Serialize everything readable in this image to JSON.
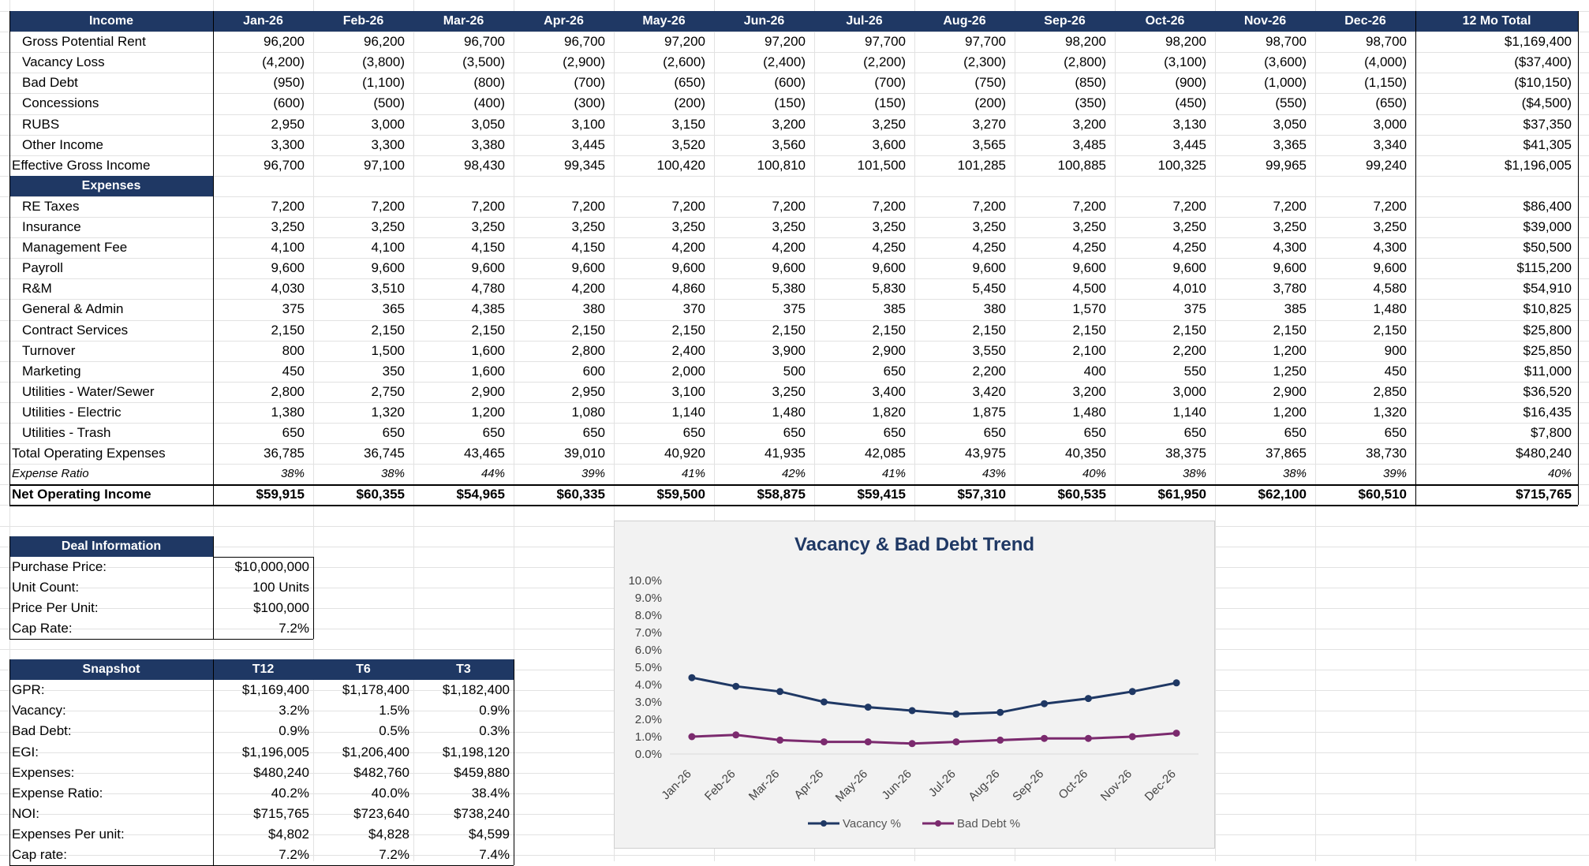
{
  "months": [
    "Jan-26",
    "Feb-26",
    "Mar-26",
    "Apr-26",
    "May-26",
    "Jun-26",
    "Jul-26",
    "Aug-26",
    "Sep-26",
    "Oct-26",
    "Nov-26",
    "Dec-26"
  ],
  "total_header": "12 Mo Total",
  "income_header": "Income",
  "expenses_header": "Expenses",
  "income_rows": [
    {
      "label": "Gross Potential Rent",
      "indent": true,
      "bold": false,
      "values": [
        "96,200",
        "96,200",
        "96,700",
        "96,700",
        "97,200",
        "97,200",
        "97,700",
        "97,700",
        "98,200",
        "98,200",
        "98,700",
        "98,700"
      ],
      "total": "$1,169,400"
    },
    {
      "label": "Vacancy Loss",
      "indent": true,
      "bold": false,
      "values": [
        "(4,200)",
        "(3,800)",
        "(3,500)",
        "(2,900)",
        "(2,600)",
        "(2,400)",
        "(2,200)",
        "(2,300)",
        "(2,800)",
        "(3,100)",
        "(3,600)",
        "(4,000)"
      ],
      "total": "($37,400)"
    },
    {
      "label": "Bad Debt",
      "indent": true,
      "bold": false,
      "values": [
        "(950)",
        "(1,100)",
        "(800)",
        "(700)",
        "(650)",
        "(600)",
        "(700)",
        "(750)",
        "(850)",
        "(900)",
        "(1,000)",
        "(1,150)"
      ],
      "total": "($10,150)"
    },
    {
      "label": "Concessions",
      "indent": true,
      "bold": false,
      "values": [
        "(600)",
        "(500)",
        "(400)",
        "(300)",
        "(200)",
        "(150)",
        "(150)",
        "(200)",
        "(350)",
        "(450)",
        "(550)",
        "(650)"
      ],
      "total": "($4,500)"
    },
    {
      "label": "RUBS",
      "indent": true,
      "bold": false,
      "values": [
        "2,950",
        "3,000",
        "3,050",
        "3,100",
        "3,150",
        "3,200",
        "3,250",
        "3,270",
        "3,200",
        "3,130",
        "3,050",
        "3,000"
      ],
      "total": "$37,350"
    },
    {
      "label": "Other Income",
      "indent": true,
      "bold": false,
      "values": [
        "3,300",
        "3,300",
        "3,380",
        "3,445",
        "3,520",
        "3,560",
        "3,600",
        "3,565",
        "3,485",
        "3,445",
        "3,365",
        "3,340"
      ],
      "total": "$41,305"
    },
    {
      "label": "Effective Gross Income",
      "indent": false,
      "bold": false,
      "values": [
        "96,700",
        "97,100",
        "98,430",
        "99,345",
        "100,420",
        "100,810",
        "101,500",
        "101,285",
        "100,885",
        "100,325",
        "99,965",
        "99,240"
      ],
      "total": "$1,196,005"
    }
  ],
  "expense_rows": [
    {
      "label": "RE Taxes",
      "indent": true,
      "values": [
        "7,200",
        "7,200",
        "7,200",
        "7,200",
        "7,200",
        "7,200",
        "7,200",
        "7,200",
        "7,200",
        "7,200",
        "7,200",
        "7,200"
      ],
      "total": "$86,400"
    },
    {
      "label": "Insurance",
      "indent": true,
      "values": [
        "3,250",
        "3,250",
        "3,250",
        "3,250",
        "3,250",
        "3,250",
        "3,250",
        "3,250",
        "3,250",
        "3,250",
        "3,250",
        "3,250"
      ],
      "total": "$39,000"
    },
    {
      "label": "Management Fee",
      "indent": true,
      "values": [
        "4,100",
        "4,100",
        "4,150",
        "4,150",
        "4,200",
        "4,200",
        "4,250",
        "4,250",
        "4,250",
        "4,250",
        "4,300",
        "4,300"
      ],
      "total": "$50,500"
    },
    {
      "label": "Payroll",
      "indent": true,
      "values": [
        "9,600",
        "9,600",
        "9,600",
        "9,600",
        "9,600",
        "9,600",
        "9,600",
        "9,600",
        "9,600",
        "9,600",
        "9,600",
        "9,600"
      ],
      "total": "$115,200"
    },
    {
      "label": "R&M",
      "indent": true,
      "values": [
        "4,030",
        "3,510",
        "4,780",
        "4,200",
        "4,860",
        "5,380",
        "5,830",
        "5,450",
        "4,500",
        "4,010",
        "3,780",
        "4,580"
      ],
      "total": "$54,910"
    },
    {
      "label": "General & Admin",
      "indent": true,
      "values": [
        "375",
        "365",
        "4,385",
        "380",
        "370",
        "375",
        "385",
        "380",
        "1,570",
        "375",
        "385",
        "1,480"
      ],
      "total": "$10,825"
    },
    {
      "label": "Contract Services",
      "indent": true,
      "values": [
        "2,150",
        "2,150",
        "2,150",
        "2,150",
        "2,150",
        "2,150",
        "2,150",
        "2,150",
        "2,150",
        "2,150",
        "2,150",
        "2,150"
      ],
      "total": "$25,800"
    },
    {
      "label": "Turnover",
      "indent": true,
      "values": [
        "800",
        "1,500",
        "1,600",
        "2,800",
        "2,400",
        "3,900",
        "2,900",
        "3,550",
        "2,100",
        "2,200",
        "1,200",
        "900"
      ],
      "total": "$25,850"
    },
    {
      "label": "Marketing",
      "indent": true,
      "values": [
        "450",
        "350",
        "1,600",
        "600",
        "2,000",
        "500",
        "650",
        "2,200",
        "400",
        "550",
        "1,250",
        "450"
      ],
      "total": "$11,000"
    },
    {
      "label": "Utilities - Water/Sewer",
      "indent": true,
      "values": [
        "2,800",
        "2,750",
        "2,900",
        "2,950",
        "3,100",
        "3,250",
        "3,400",
        "3,420",
        "3,200",
        "3,000",
        "2,900",
        "2,850"
      ],
      "total": "$36,520"
    },
    {
      "label": "Utilities - Electric",
      "indent": true,
      "values": [
        "1,380",
        "1,320",
        "1,200",
        "1,080",
        "1,140",
        "1,480",
        "1,820",
        "1,875",
        "1,480",
        "1,140",
        "1,200",
        "1,320"
      ],
      "total": "$16,435"
    },
    {
      "label": "Utilities - Trash",
      "indent": true,
      "values": [
        "650",
        "650",
        "650",
        "650",
        "650",
        "650",
        "650",
        "650",
        "650",
        "650",
        "650",
        "650"
      ],
      "total": "$7,800"
    },
    {
      "label": "Total Operating Expenses",
      "indent": false,
      "values": [
        "36,785",
        "36,745",
        "43,465",
        "39,010",
        "40,920",
        "41,935",
        "42,085",
        "43,975",
        "40,350",
        "38,375",
        "37,865",
        "38,730"
      ],
      "total": "$480,240"
    }
  ],
  "expense_ratio": {
    "label": "Expense Ratio",
    "values": [
      "38%",
      "38%",
      "44%",
      "39%",
      "41%",
      "42%",
      "41%",
      "43%",
      "40%",
      "38%",
      "38%",
      "39%"
    ],
    "total": "40%"
  },
  "noi": {
    "label": "Net Operating Income",
    "values": [
      "$59,915",
      "$60,355",
      "$54,965",
      "$60,335",
      "$59,500",
      "$58,875",
      "$59,415",
      "$57,310",
      "$60,535",
      "$61,950",
      "$62,100",
      "$60,510"
    ],
    "total": "$715,765"
  },
  "deal": {
    "header": "Deal Information",
    "rows": [
      {
        "label": "Purchase Price:",
        "value": "$10,000,000"
      },
      {
        "label": "Unit Count:",
        "value": "100 Units"
      },
      {
        "label": "Price Per Unit:",
        "value": "$100,000"
      },
      {
        "label": "Cap Rate:",
        "value": "7.2%"
      }
    ]
  },
  "snapshot": {
    "header": "Snapshot",
    "columns": [
      "T12",
      "T6",
      "T3"
    ],
    "rows": [
      {
        "label": "GPR:",
        "values": [
          "$1,169,400",
          "$1,178,400",
          "$1,182,400"
        ]
      },
      {
        "label": "Vacancy:",
        "values": [
          "3.2%",
          "1.5%",
          "0.9%"
        ]
      },
      {
        "label": "Bad Debt:",
        "values": [
          "0.9%",
          "0.5%",
          "0.3%"
        ]
      },
      {
        "label": "EGI:",
        "values": [
          "$1,196,005",
          "$1,206,400",
          "$1,198,120"
        ]
      },
      {
        "label": "Expenses:",
        "values": [
          "$480,240",
          "$482,760",
          "$459,880"
        ]
      },
      {
        "label": "Expense Ratio:",
        "values": [
          "40.2%",
          "40.0%",
          "38.4%"
        ]
      },
      {
        "label": "NOI:",
        "values": [
          "$715,765",
          "$723,640",
          "$738,240"
        ]
      },
      {
        "label": "Expenses Per unit:",
        "values": [
          "$4,802",
          "$4,828",
          "$4,599"
        ]
      },
      {
        "label": "Cap rate:",
        "values": [
          "7.2%",
          "7.2%",
          "7.4%"
        ]
      }
    ]
  },
  "chart_data": {
    "type": "line",
    "title": "Vacancy & Bad Debt Trend",
    "categories": [
      "Jan-26",
      "Feb-26",
      "Mar-26",
      "Apr-26",
      "May-26",
      "Jun-26",
      "Jul-26",
      "Aug-26",
      "Sep-26",
      "Oct-26",
      "Nov-26",
      "Dec-26"
    ],
    "y_ticks": [
      "10.0%",
      "9.0%",
      "8.0%",
      "7.0%",
      "6.0%",
      "5.0%",
      "4.0%",
      "3.0%",
      "2.0%",
      "1.0%",
      "0.0%"
    ],
    "ylim": [
      0,
      10
    ],
    "series": [
      {
        "name": "Vacancy %",
        "color": "#1f3864",
        "values": [
          4.4,
          3.9,
          3.6,
          3.0,
          2.7,
          2.5,
          2.3,
          2.4,
          2.9,
          3.2,
          3.6,
          4.1
        ]
      },
      {
        "name": "Bad Debt %",
        "color": "#7b2a6e",
        "values": [
          1.0,
          1.1,
          0.8,
          0.7,
          0.7,
          0.6,
          0.7,
          0.8,
          0.9,
          0.9,
          1.0,
          1.2
        ]
      }
    ],
    "grid": false,
    "legend": "bottom"
  },
  "colors": {
    "header_fill": "#1f3864",
    "header_text": "#ffffff"
  }
}
